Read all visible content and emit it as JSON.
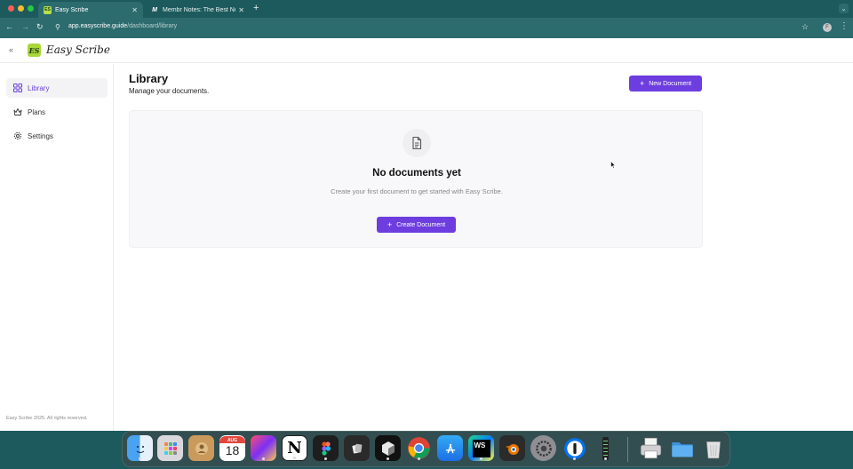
{
  "browser": {
    "tabs": [
      {
        "title": "Easy Scribe",
        "favicon": "ES",
        "active": true
      },
      {
        "title": "Membr Notes: The Best Note",
        "favicon": "M",
        "active": false
      }
    ],
    "url_host": "app.easyscribe.guide",
    "url_path": "/dashboard/library",
    "profile_initial": "F"
  },
  "app": {
    "logo_initials": "ES",
    "logo_text": "Easy Scribe",
    "sidebar": {
      "items": [
        {
          "label": "Library",
          "icon": "grid-icon",
          "active": true
        },
        {
          "label": "Plans",
          "icon": "crown-icon",
          "active": false
        },
        {
          "label": "Settings",
          "icon": "gear-icon",
          "active": false
        }
      ],
      "footer": "Easy Scribe 2025. All rights reserved."
    },
    "main": {
      "title": "Library",
      "subtitle": "Manage your documents.",
      "new_document_label": "New Document",
      "empty_state": {
        "title": "No documents yet",
        "description": "Create your first document to get started with Easy Scribe.",
        "create_label": "Create Document"
      }
    }
  },
  "dock": {
    "calendar_month": "AUG",
    "calendar_day": "18",
    "apps": [
      "Finder",
      "Launchpad",
      "Contacts",
      "Calendar",
      "Arc",
      "Notion",
      "Figma",
      "Capacities",
      "Cursor",
      "Chrome",
      "App Store",
      "WebStorm",
      "Blender",
      "System Settings",
      "1Password",
      "Audio Meter",
      "Print",
      "Folder",
      "Trash"
    ]
  },
  "colors": {
    "accent": "#6d3ddf",
    "chrome": "#1d5a5d",
    "logo_green": "#a9d63a"
  }
}
